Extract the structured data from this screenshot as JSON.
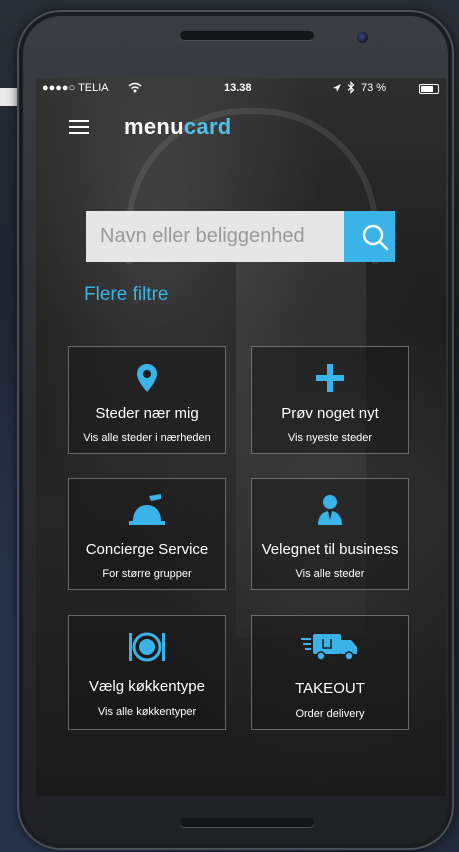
{
  "status_bar": {
    "carrier": "●●●●○ TELIA",
    "time": "13.38",
    "battery": "73 %"
  },
  "nav": {
    "logo_main": "menu",
    "logo_accent": "card"
  },
  "search": {
    "placeholder": "Navn eller beliggenhed"
  },
  "filters_link": "Flere filtre",
  "tiles": [
    {
      "title": "Steder nær mig",
      "subtitle": "Vis alle steder i nærheden",
      "icon": "map-pin-icon"
    },
    {
      "title": "Prøv noget nyt",
      "subtitle": "Vis nyeste steder",
      "icon": "plus-icon"
    },
    {
      "title": "Concierge Service",
      "subtitle": "For større grupper",
      "icon": "service-bell-icon"
    },
    {
      "title": "Velegnet til business",
      "subtitle": "Vis alle steder",
      "icon": "businessman-icon"
    },
    {
      "title": "Vælg køkkentype",
      "subtitle": "Vis alle køkkentyper",
      "icon": "plate-cutlery-icon"
    },
    {
      "title": "TAKEOUT",
      "subtitle": "Order delivery",
      "icon": "delivery-truck-icon"
    }
  ],
  "colors": {
    "accent": "#3ab3e8",
    "logo_accent": "#4fc1ea"
  }
}
